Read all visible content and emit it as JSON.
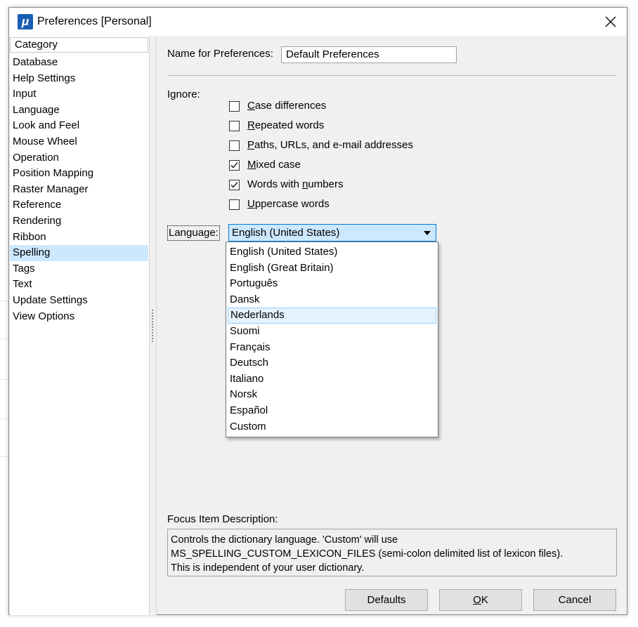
{
  "window": {
    "title": "Preferences [Personal]",
    "app_icon_glyph": "μ"
  },
  "category": {
    "header": "Category",
    "selected": "Spelling",
    "items": [
      "Database",
      "Help Settings",
      "Input",
      "Language",
      "Look and Feel",
      "Mouse Wheel",
      "Operation",
      "Position Mapping",
      "Raster Manager",
      "Reference",
      "Rendering",
      "Ribbon",
      "Spelling",
      "Tags",
      "Text",
      "Update Settings",
      "View Options"
    ]
  },
  "form": {
    "name_label": "Name for Preferences:",
    "name_value": "Default Preferences",
    "ignore_label": "Ignore:",
    "checkboxes": [
      {
        "pre": "",
        "mn": "C",
        "post": "ase differences",
        "checked": false
      },
      {
        "pre": "",
        "mn": "R",
        "post": "epeated words",
        "checked": false
      },
      {
        "pre": "",
        "mn": "P",
        "post": "aths, URLs, and e-mail addresses",
        "checked": false
      },
      {
        "pre": "",
        "mn": "M",
        "post": "ixed case",
        "checked": true
      },
      {
        "pre": "Words with ",
        "mn": "n",
        "post": "umbers",
        "checked": true
      },
      {
        "pre": "",
        "mn": "U",
        "post": "ppercase words",
        "checked": false
      }
    ],
    "language_label": "Language:",
    "language_value": "English (United States)",
    "language_options": [
      "English (United States)",
      "English (Great Britain)",
      "Português",
      "Dansk",
      "Nederlands",
      "Suomi",
      "Français",
      "Deutsch",
      "Italiano",
      "Norsk",
      "Español",
      "Custom"
    ],
    "language_hovered": "Nederlands"
  },
  "focus": {
    "label": "Focus Item Description:",
    "lines": [
      "Controls the dictionary language. 'Custom' will use",
      "MS_SPELLING_CUSTOM_LEXICON_FILES (semi-colon delimited list of lexicon files).",
      "This is independent of your user dictionary."
    ]
  },
  "buttons": {
    "defaults": "Defaults",
    "ok_mn": "O",
    "ok_post": "K",
    "cancel": "Cancel"
  },
  "icons": {
    "app": "app-icon",
    "close": "close-icon",
    "check": "checkmark-icon",
    "dropdown_arrow": "dropdown-arrow-icon"
  },
  "colors": {
    "selection": "#cce8ff",
    "combo_border": "#0078d7",
    "hover_bg": "#e5f3ff",
    "hover_border": "#99d1ff"
  }
}
